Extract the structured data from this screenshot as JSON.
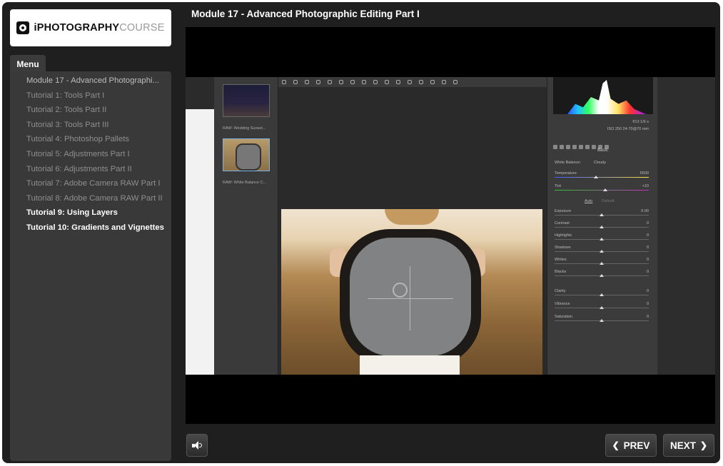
{
  "logo": {
    "strong": "iPHOTOGRAPHY",
    "light": "COURSE"
  },
  "menu": {
    "tab_label": "Menu",
    "items": [
      {
        "label": "Module 17 - Advanced Photographi...",
        "state": "current"
      },
      {
        "label": "Tutorial 1: Tools Part I",
        "state": "normal"
      },
      {
        "label": "Tutorial 2: Tools Part II",
        "state": "normal"
      },
      {
        "label": "Tutorial 3: Tools Part III",
        "state": "normal"
      },
      {
        "label": "Tutorial 4: Photoshop Pallets",
        "state": "normal"
      },
      {
        "label": "Tutorial 5: Adjustments Part I",
        "state": "normal"
      },
      {
        "label": "Tutorial 6: Adjustments Part II",
        "state": "normal"
      },
      {
        "label": "Tutorial 7: Adobe Camera RAW Part I",
        "state": "normal"
      },
      {
        "label": "Tutorial 8: Adobe Camera RAW Part II",
        "state": "normal"
      },
      {
        "label": "Tutorial 9: Using Layers",
        "state": "bright"
      },
      {
        "label": "Tutorial 10: Gradients and Vignettes",
        "state": "bright"
      }
    ]
  },
  "header": {
    "title": "Module 17 - Advanced Photographic Editing Part I"
  },
  "video": {
    "thumbnails": [
      "RAW: Wedding Sunset...",
      "RAW: White Balance C..."
    ],
    "panel": {
      "meta_line1": "f/13   1/6 s",
      "meta_line2": "ISO 250   24-70@70 mm",
      "section": "Basic",
      "white_balance_label": "White Balance:",
      "white_balance_value": "Cloudy",
      "temperature_label": "Temperature",
      "temperature_value": "6500",
      "tint_label": "Tint",
      "tint_value": "+10",
      "auto_label": "Auto",
      "default_label": "Default",
      "sliders": [
        {
          "label": "Exposure",
          "value": "0.00"
        },
        {
          "label": "Contrast",
          "value": "0"
        },
        {
          "label": "Highlights",
          "value": "0"
        },
        {
          "label": "Shadows",
          "value": "0"
        },
        {
          "label": "Whites",
          "value": "0"
        },
        {
          "label": "Blacks",
          "value": "0"
        },
        {
          "label": "Clarity",
          "value": "0"
        },
        {
          "label": "Vibrance",
          "value": "0"
        },
        {
          "label": "Saturation",
          "value": "0"
        }
      ]
    }
  },
  "controls": {
    "sound_icon": "speaker-icon",
    "prev_label": "PREV",
    "next_label": "NEXT"
  },
  "colors": {
    "frame_bg": "#1f1f1f",
    "menu_bg": "#393939",
    "text_muted": "#8f8f8f",
    "text_bright": "#ffffff"
  }
}
